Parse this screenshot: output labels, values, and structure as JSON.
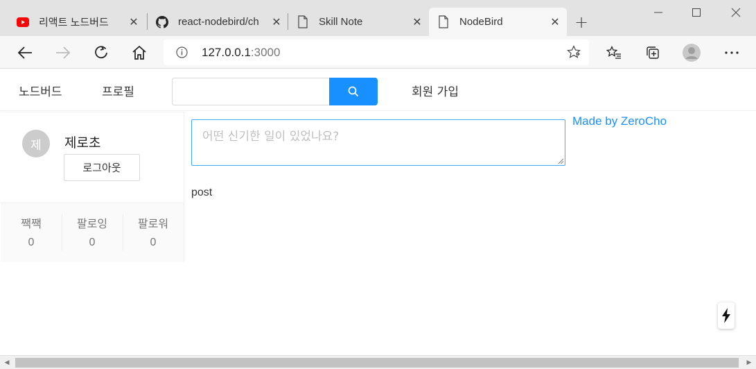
{
  "browser": {
    "tabs": [
      {
        "title": "리액트 노드버드 ",
        "icon": "youtube-icon"
      },
      {
        "title": "react-nodebird/ch",
        "icon": "github-icon"
      },
      {
        "title": "Skill Note",
        "icon": "page-icon"
      },
      {
        "title": "NodeBird",
        "icon": "page-icon",
        "active": true
      }
    ],
    "url_host": "127.0.0.1",
    "url_port": ":3000",
    "accent_color": "#1890ff"
  },
  "nav": {
    "home_label": "노드버드",
    "profile_label": "프로필",
    "search_placeholder": "",
    "signup_label": "회원 가입"
  },
  "user_card": {
    "avatar_initial": "제",
    "nickname": "제로초",
    "logout_label": "로그아웃",
    "stats": [
      {
        "label": "짹짹",
        "value": "0"
      },
      {
        "label": "팔로잉",
        "value": "0"
      },
      {
        "label": "팔로워",
        "value": "0"
      }
    ]
  },
  "post_form": {
    "placeholder": "어떤 신기한 일이 있었나요?"
  },
  "feed": {
    "post_text": "post"
  },
  "footer": {
    "credit": "Made by ZeroCho"
  }
}
